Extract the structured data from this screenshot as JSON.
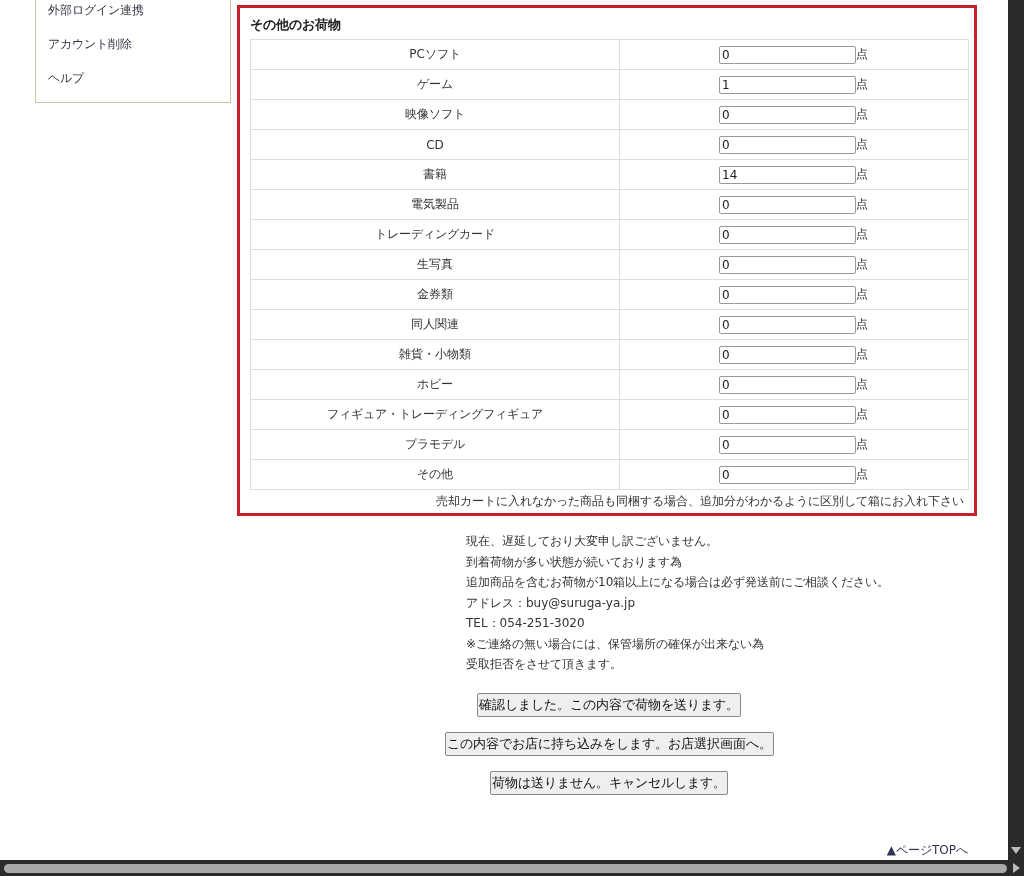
{
  "sidebar": {
    "items": [
      {
        "label": "外部ログイン連携"
      },
      {
        "label": "アカウント削除"
      },
      {
        "label": "ヘルプ"
      }
    ]
  },
  "cargo": {
    "title": "その他のお荷物",
    "rows": [
      {
        "label": "PCソフト",
        "value": "0",
        "unit": "点"
      },
      {
        "label": "ゲーム",
        "value": "1",
        "unit": "点"
      },
      {
        "label": "映像ソフト",
        "value": "0",
        "unit": "点"
      },
      {
        "label": "CD",
        "value": "0",
        "unit": "点"
      },
      {
        "label": "書籍",
        "value": "14",
        "unit": "点"
      },
      {
        "label": "電気製品",
        "value": "0",
        "unit": "点"
      },
      {
        "label": "トレーディングカード",
        "value": "0",
        "unit": "点"
      },
      {
        "label": "生写真",
        "value": "0",
        "unit": "点"
      },
      {
        "label": "金券類",
        "value": "0",
        "unit": "点"
      },
      {
        "label": "同人関連",
        "value": "0",
        "unit": "点"
      },
      {
        "label": "雑貨・小物類",
        "value": "0",
        "unit": "点"
      },
      {
        "label": "ホビー",
        "value": "0",
        "unit": "点"
      },
      {
        "label": "フィギュア・トレーディングフィギュア",
        "value": "0",
        "unit": "点"
      },
      {
        "label": "プラモデル",
        "value": "0",
        "unit": "点"
      },
      {
        "label": "その他",
        "value": "0",
        "unit": "点"
      }
    ],
    "note": "売却カートに入れなかった商品も同梱する場合、追加分がわかるように区別して箱にお入れ下さい"
  },
  "notice": [
    "現在、遅延しており大変申し訳ございません。",
    "到着荷物が多い状態が続いております為",
    "追加商品を含むお荷物が10箱以上になる場合は必ず発送前にご相談ください。",
    "アドレス：buy@suruga-ya.jp",
    "TEL：054-251-3020",
    "※ご連絡の無い場合には、保管場所の確保が出来ない為",
    "受取拒否をさせて頂きます。"
  ],
  "buttons": [
    "確認しました。この内容で荷物を送ります。",
    "この内容でお店に持ち込みをします。お店選択画面へ。",
    "荷物は送りません。キャンセルします。"
  ],
  "page_top": "▲ページTOPへ"
}
